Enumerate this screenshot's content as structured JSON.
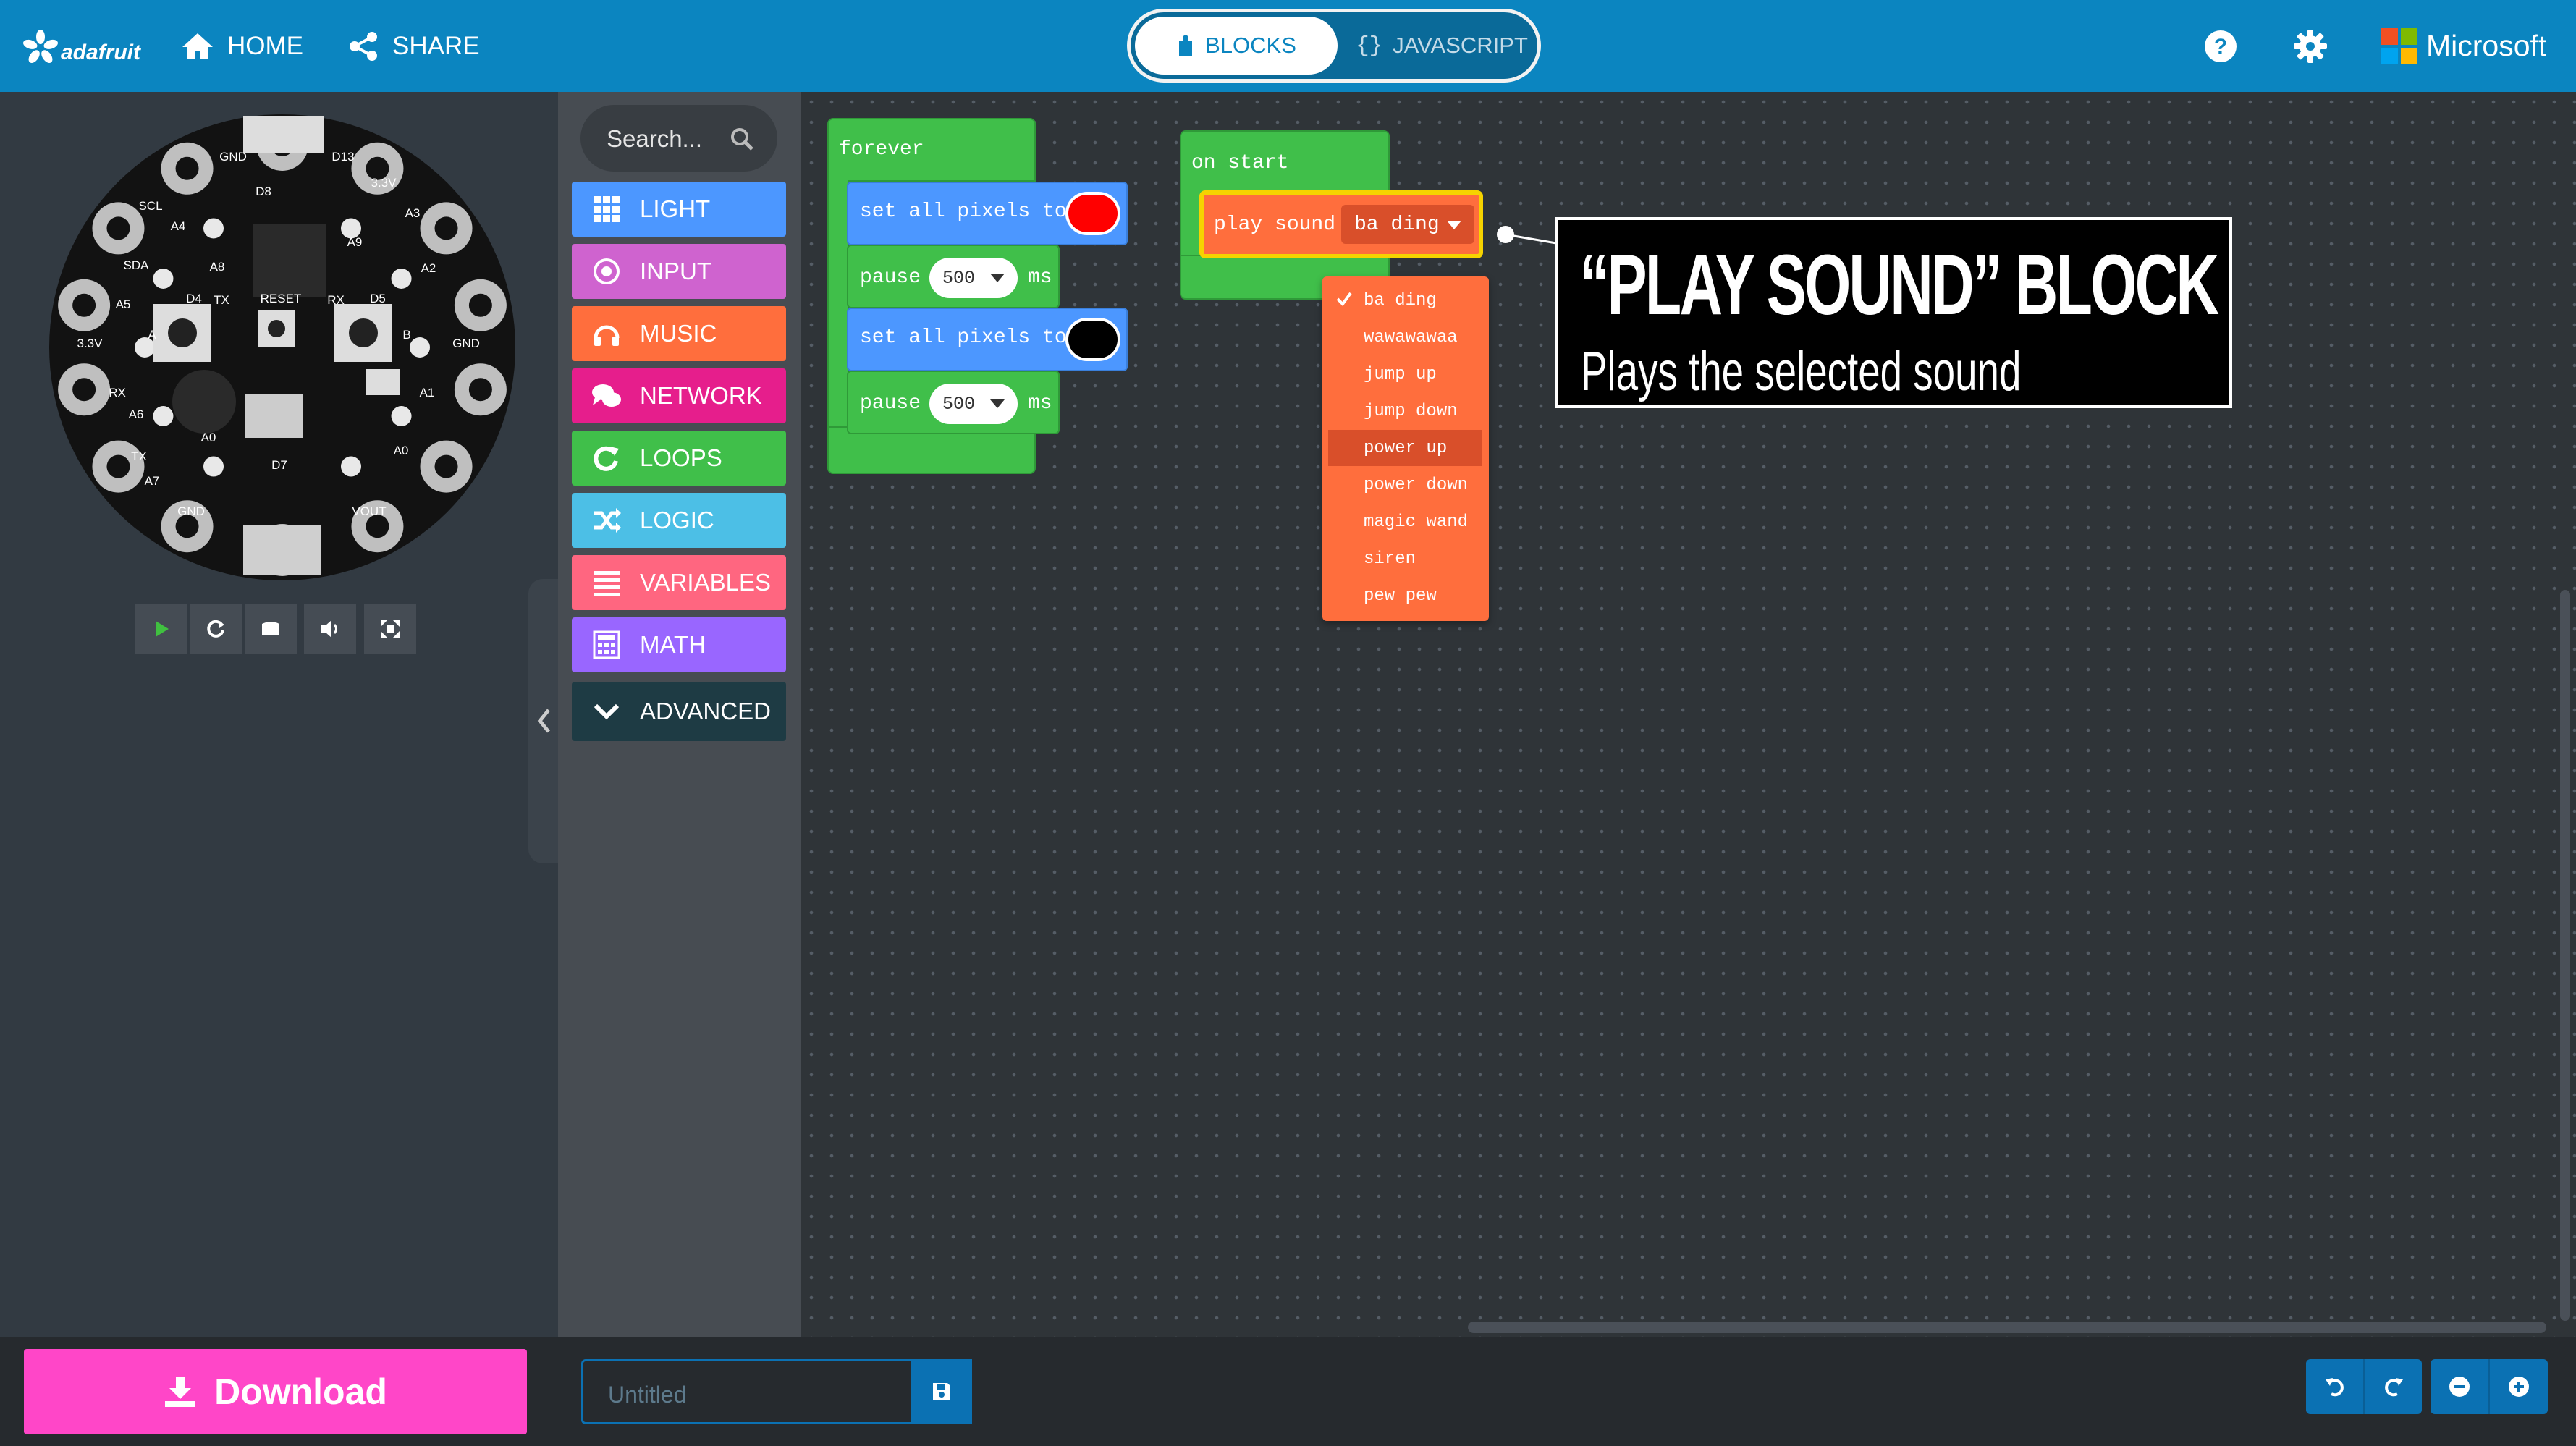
{
  "header": {
    "logo_text": "adafruit",
    "home_label": "HOME",
    "share_label": "SHARE",
    "blocks_label": "BLOCKS",
    "javascript_label": "JAVASCRIPT",
    "brand_label": "Microsoft"
  },
  "toolbox": {
    "search_placeholder": "Search...",
    "categories": [
      {
        "label": "LIGHT",
        "color": "#4c97ff"
      },
      {
        "label": "INPUT",
        "color": "#cf63cf"
      },
      {
        "label": "MUSIC",
        "color": "#ff6e3d"
      },
      {
        "label": "NETWORK",
        "color": "#e61e8c"
      },
      {
        "label": "LOOPS",
        "color": "#40bf4a"
      },
      {
        "label": "LOGIC",
        "color": "#4cbfe6"
      },
      {
        "label": "VARIABLES",
        "color": "#ff6680"
      },
      {
        "label": "MATH",
        "color": "#9966ff"
      }
    ],
    "advanced_label": "ADVANCED"
  },
  "blocks": {
    "forever": {
      "label": "forever",
      "set_pixels_1": {
        "label": "set all pixels to",
        "color": "#ff0000"
      },
      "pause_1": {
        "label": "pause",
        "value": "500",
        "unit": "ms"
      },
      "set_pixels_2": {
        "label": "set all pixels to",
        "color": "#000000"
      },
      "pause_2": {
        "label": "pause",
        "value": "500",
        "unit": "ms"
      }
    },
    "on_start": {
      "label": "on start",
      "play_sound": {
        "label": "play sound",
        "selected": "ba ding"
      }
    }
  },
  "sound_dropdown": {
    "options": [
      "ba ding",
      "wawawawaa",
      "jump up",
      "jump down",
      "power up",
      "power down",
      "magic wand",
      "siren",
      "pew pew"
    ],
    "checked": "ba ding",
    "highlighted": "power up"
  },
  "callout": {
    "title": "“PLAY SOUND” BLOCK",
    "subtitle": "Plays the selected sound"
  },
  "simulator": {
    "board_labels": [
      "GND",
      "D13",
      "D8",
      "3.3V",
      "SCL",
      "A4",
      "A3",
      "A9",
      "A8",
      "SDA",
      "A5",
      "A2",
      "TX",
      "RESET",
      "RX",
      "D4",
      "D5",
      "A",
      "B",
      "3.3V",
      "GND",
      "RX",
      "A6",
      "A1",
      "A0",
      "TX",
      "A7",
      "D7",
      "A0",
      "GND",
      "VOUT"
    ]
  },
  "footer": {
    "download_label": "Download",
    "project_name_placeholder": "Untitled"
  },
  "colors": {
    "header": "#0b85c0",
    "download": "#ff46c8",
    "loops_green": "#40bf4a",
    "light_blue": "#4c97ff",
    "music_orange": "#ff6e3d"
  }
}
